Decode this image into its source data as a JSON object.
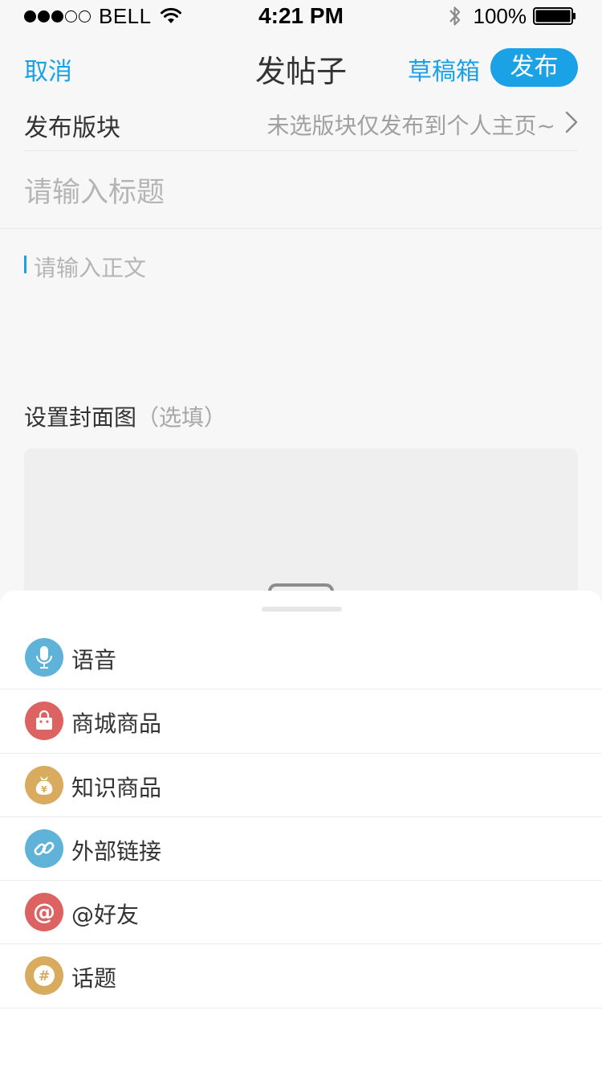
{
  "status_bar": {
    "carrier": "BELL",
    "time": "4:21 PM",
    "battery": "100%"
  },
  "nav": {
    "cancel": "取消",
    "title": "发帖子",
    "drafts": "草稿箱",
    "publish": "发布"
  },
  "section": {
    "label": "发布版块",
    "value": "未选版块仅发布到个人主页~"
  },
  "title_input": {
    "placeholder": "请输入标题"
  },
  "body_input": {
    "placeholder": "请输入正文"
  },
  "cover": {
    "label": "设置封面图",
    "optional": "（选填）"
  },
  "colors": {
    "accent": "#1aa1e6",
    "blue_icon": "#5fb3d9",
    "red_icon": "#dd6262",
    "gold_icon": "#d9ab5f"
  },
  "sheet": {
    "items": [
      {
        "label": "语音",
        "icon": "microphone-icon",
        "color": "#5fb3d9"
      },
      {
        "label": "商城商品",
        "icon": "shopping-bag-icon",
        "color": "#dd6262"
      },
      {
        "label": "知识商品",
        "icon": "money-bag-icon",
        "color": "#d9ab5f"
      },
      {
        "label": "外部链接",
        "icon": "link-icon",
        "color": "#5fb3d9"
      },
      {
        "label": "@好友",
        "icon": "at-icon",
        "color": "#dd6262"
      },
      {
        "label": "话题",
        "icon": "hashtag-icon",
        "color": "#d9ab5f"
      }
    ]
  }
}
